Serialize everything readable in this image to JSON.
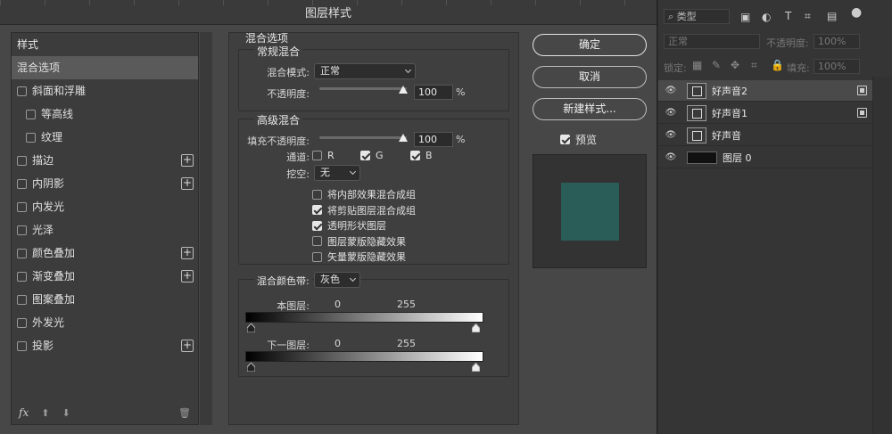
{
  "dialog": {
    "title": "图层样式",
    "style_list": {
      "header": "样式",
      "items": [
        {
          "label": "混合选项",
          "checkbox": false,
          "selected": true,
          "plus": false,
          "indent": false
        },
        {
          "label": "斜面和浮雕",
          "checkbox": true,
          "plus": false,
          "indent": false
        },
        {
          "label": "等高线",
          "checkbox": true,
          "plus": false,
          "indent": true
        },
        {
          "label": "纹理",
          "checkbox": true,
          "plus": false,
          "indent": true
        },
        {
          "label": "描边",
          "checkbox": true,
          "plus": true,
          "indent": false
        },
        {
          "label": "内阴影",
          "checkbox": true,
          "plus": true,
          "indent": false
        },
        {
          "label": "内发光",
          "checkbox": true,
          "plus": false,
          "indent": false
        },
        {
          "label": "光泽",
          "checkbox": true,
          "plus": false,
          "indent": false
        },
        {
          "label": "颜色叠加",
          "checkbox": true,
          "plus": true,
          "indent": false
        },
        {
          "label": "渐变叠加",
          "checkbox": true,
          "plus": true,
          "indent": false
        },
        {
          "label": "图案叠加",
          "checkbox": true,
          "plus": false,
          "indent": false
        },
        {
          "label": "外发光",
          "checkbox": true,
          "plus": false,
          "indent": false
        },
        {
          "label": "投影",
          "checkbox": true,
          "plus": true,
          "indent": false
        }
      ],
      "footer": {
        "fx": "fx"
      }
    },
    "blend_options": {
      "title": "混合选项",
      "general": {
        "title": "常规混合",
        "mode_label": "混合模式:",
        "mode_value": "正常",
        "opacity_label": "不透明度:",
        "opacity_value": "100",
        "unit": "%"
      },
      "advanced": {
        "title": "高级混合",
        "fill_label": "填充不透明度:",
        "fill_value": "100",
        "unit": "%",
        "channels_label": "通道:",
        "channel_r": "R",
        "channel_g": "G",
        "channel_b": "B",
        "knockout_label": "挖空:",
        "knockout_value": "无",
        "options": [
          {
            "label": "将内部效果混合成组",
            "checked": false
          },
          {
            "label": "将剪贴图层混合成组",
            "checked": true
          },
          {
            "label": "透明形状图层",
            "checked": true
          },
          {
            "label": "图层蒙版隐藏效果",
            "checked": false
          },
          {
            "label": "矢量蒙版隐藏效果",
            "checked": false
          }
        ]
      },
      "blend_if": {
        "label": "混合颜色带:",
        "value": "灰色",
        "this_layer_label": "本图层:",
        "this_layer_min": "0",
        "this_layer_max": "255",
        "underlying_label": "下一图层:",
        "underlying_min": "0",
        "underlying_max": "255"
      }
    },
    "buttons": {
      "ok": "确定",
      "cancel": "取消",
      "new_style": "新建样式...",
      "preview": "预览"
    },
    "preview_color": "#2a5c58"
  },
  "layers_panel": {
    "filter_label": "类型",
    "blend_mode": "正常",
    "opacity_label": "不透明度:",
    "opacity_value": "100%",
    "lock_label": "锁定:",
    "fill_label": "填充:",
    "fill_value": "100%",
    "layers": [
      {
        "name": "好声音2",
        "active": true,
        "smart": true
      },
      {
        "name": "好声音1",
        "active": false,
        "smart": true
      },
      {
        "name": "好声音",
        "active": false,
        "smart": false
      },
      {
        "name": "图层 0",
        "active": false,
        "smart": false
      }
    ]
  }
}
